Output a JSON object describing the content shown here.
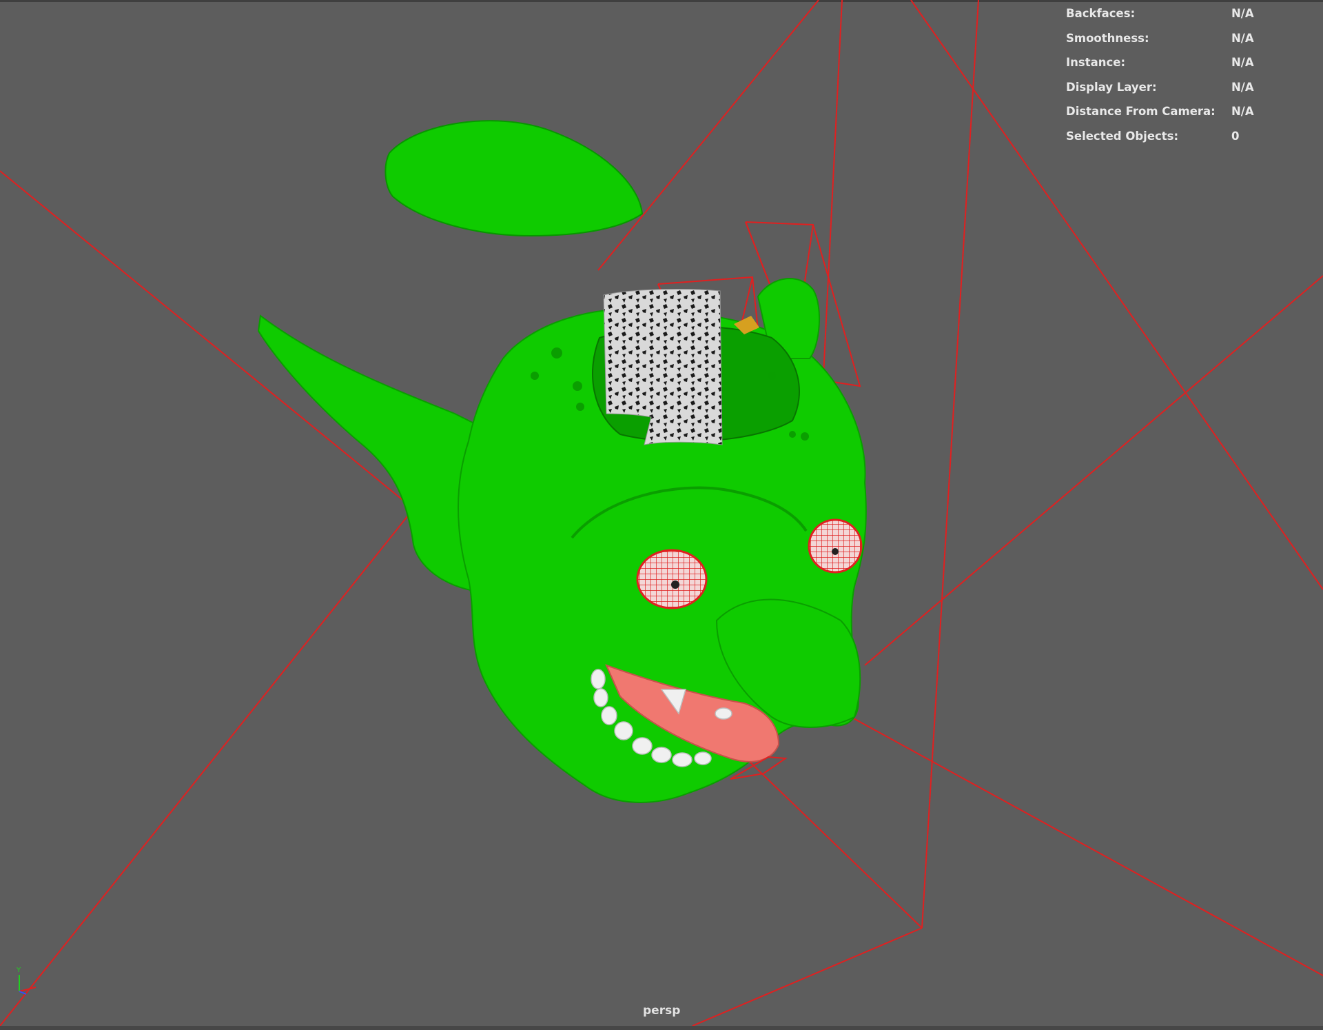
{
  "hud": {
    "rows": [
      {
        "label": "Backfaces:",
        "value": "N/A"
      },
      {
        "label": "Smoothness:",
        "value": "N/A"
      },
      {
        "label": "Instance:",
        "value": "N/A"
      },
      {
        "label": "Display Layer:",
        "value": "N/A"
      },
      {
        "label": "Distance From Camera:",
        "value": "N/A"
      },
      {
        "label": "Selected Objects:",
        "value": "0"
      }
    ]
  },
  "camera": {
    "name": "persp"
  },
  "axis_gizmo": {
    "y_label": "Y"
  },
  "colors": {
    "background": "#5d5d5d",
    "mesh_green": "#0fcb00",
    "wireframe_red": "#e02020",
    "tongue": "#f07870",
    "teeth": "#f0f0f0",
    "hud_text": "#e9e9e9"
  }
}
